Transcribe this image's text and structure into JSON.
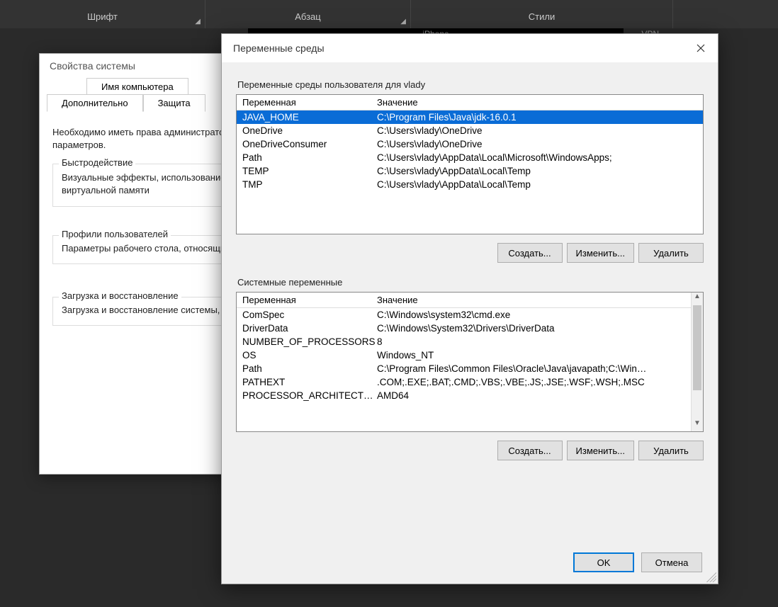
{
  "ribbon": {
    "group_font": "Шрифт",
    "group_paragraph": "Абзац",
    "group_styles": "Стили"
  },
  "strip": {
    "center": "iPhone",
    "right": "VPN"
  },
  "sysprops": {
    "title": "Свойства системы",
    "tab_computer_name": "Имя компьютера",
    "tab_advanced": "Дополнительно",
    "tab_protection": "Защита",
    "intro": "Необходимо иметь права администратора для изменения перечисленных параметров.",
    "perf_legend": "Быстродействие",
    "perf_text": "Визуальные эффекты, использование процессора, оперативной и виртуальной памяти",
    "profiles_legend": "Профили пользователей",
    "profiles_text": "Параметры рабочего стола, относящиеся ко входу в систему",
    "startup_legend": "Загрузка и восстановление",
    "startup_text": "Загрузка и восстановление системы, отладочная информация"
  },
  "env": {
    "title": "Переменные среды",
    "user_section": "Переменные среды пользователя для vlady",
    "sys_section": "Системные переменные",
    "col_var": "Переменная",
    "col_val": "Значение",
    "user_vars": [
      {
        "name": "JAVA_HOME",
        "value": "C:\\Program Files\\Java\\jdk-16.0.1",
        "selected": true
      },
      {
        "name": "OneDrive",
        "value": "C:\\Users\\vlady\\OneDrive"
      },
      {
        "name": "OneDriveConsumer",
        "value": "C:\\Users\\vlady\\OneDrive"
      },
      {
        "name": "Path",
        "value": "C:\\Users\\vlady\\AppData\\Local\\Microsoft\\WindowsApps;"
      },
      {
        "name": "TEMP",
        "value": "C:\\Users\\vlady\\AppData\\Local\\Temp"
      },
      {
        "name": "TMP",
        "value": "C:\\Users\\vlady\\AppData\\Local\\Temp"
      }
    ],
    "sys_vars": [
      {
        "name": "ComSpec",
        "value": "C:\\Windows\\system32\\cmd.exe"
      },
      {
        "name": "DriverData",
        "value": "C:\\Windows\\System32\\Drivers\\DriverData"
      },
      {
        "name": "NUMBER_OF_PROCESSORS",
        "value": "8"
      },
      {
        "name": "OS",
        "value": "Windows_NT"
      },
      {
        "name": "Path",
        "value": "C:\\Program Files\\Common Files\\Oracle\\Java\\javapath;C:\\Win…"
      },
      {
        "name": "PATHEXT",
        "value": ".COM;.EXE;.BAT;.CMD;.VBS;.VBE;.JS;.JSE;.WSF;.WSH;.MSC"
      },
      {
        "name": "PROCESSOR_ARCHITECTU...",
        "value": "AMD64"
      }
    ],
    "btn_new": "Создать...",
    "btn_edit": "Изменить...",
    "btn_delete": "Удалить",
    "btn_ok": "OK",
    "btn_cancel": "Отмена"
  }
}
